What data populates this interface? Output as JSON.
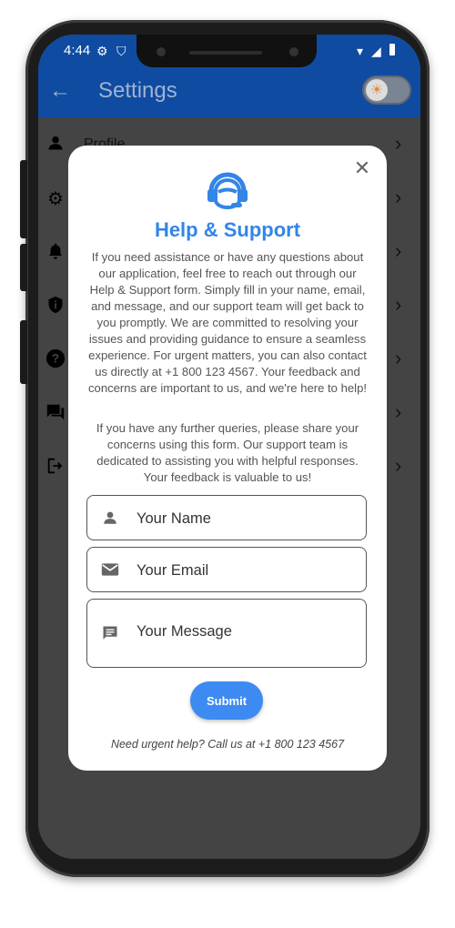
{
  "status_bar": {
    "time": "4:44"
  },
  "app_bar": {
    "back_icon": "arrow-left-icon",
    "title": "Settings",
    "theme_toggle_icon": "sun-icon"
  },
  "settings_list": {
    "items": [
      {
        "label": "Profile",
        "icon": "person-icon"
      },
      {
        "label": "",
        "icon": "gear-icon"
      },
      {
        "label": "",
        "icon": "bell-icon"
      },
      {
        "label": "",
        "icon": "shield-icon"
      },
      {
        "label": "",
        "icon": "help-icon"
      },
      {
        "label": "",
        "icon": "chat-icon"
      },
      {
        "label": "",
        "icon": "logout-icon"
      }
    ]
  },
  "dialog": {
    "title": "Help & Support",
    "icon": "headset-icon",
    "paragraph_1": "If you need assistance or have any questions about our application, feel free to reach out through our Help & Support form. Simply fill in your name, email, and message, and our support team will get back to you promptly. We are committed to resolving your issues and providing guidance to ensure a seamless experience. For urgent matters, you can also contact us directly at +1 800 123 4567. Your feedback and concerns are important to us, and we're here to help!",
    "paragraph_2": "If you have any further queries, please share your concerns using this form. Our support team is dedicated to assisting you with helpful responses. Your feedback is valuable to us!",
    "name_placeholder": "Your Name",
    "email_placeholder": "Your Email",
    "message_placeholder": "Your Message",
    "submit_label": "Submit",
    "footer_text": "Need urgent help? Call us at +1 800 123 4567"
  },
  "colors": {
    "app_bar": "#0f4ba1",
    "accent": "#3385e6",
    "button": "#3d8bf2"
  }
}
